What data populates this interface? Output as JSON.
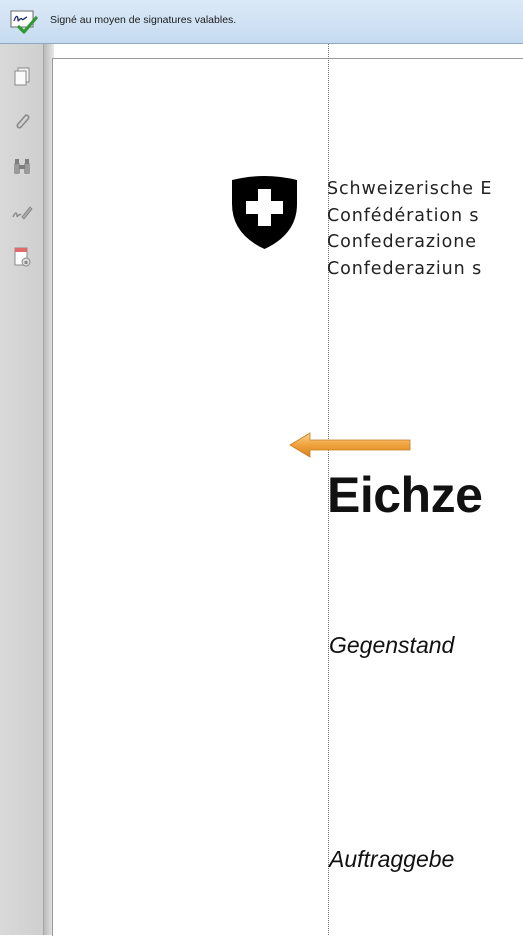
{
  "signature_bar": {
    "status_text": "Signé au moyen de signatures valables.",
    "icon": "signature-valid-icon"
  },
  "nav_rail": {
    "items": [
      {
        "icon": "pages-icon"
      },
      {
        "icon": "paperclip-icon"
      },
      {
        "icon": "binoculars-icon"
      },
      {
        "icon": "signature-pen-icon"
      },
      {
        "icon": "document-lock-icon"
      }
    ]
  },
  "document": {
    "confederation_lines": [
      "Schweizerische E",
      "Confédération s",
      "Confederazione",
      "Confederaziun s"
    ],
    "title": "Eichze",
    "subject_label": "Gegenstand",
    "client_label": "Auftraggebe"
  },
  "colors": {
    "sig_bar_bg": "#c6dbf0",
    "rail_bg": "#d4d4d4",
    "arrow": "#f0a23c",
    "shield": "#000000"
  }
}
